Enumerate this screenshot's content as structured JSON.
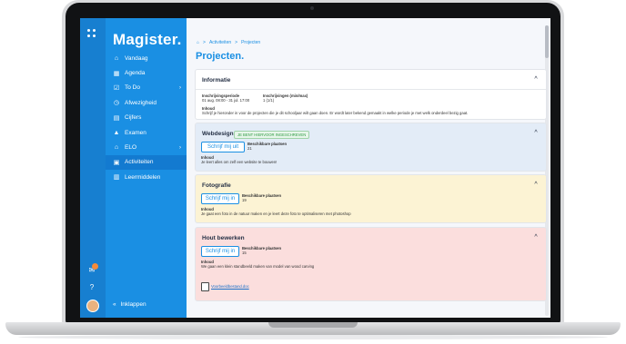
{
  "app": {
    "name": "Magister."
  },
  "sidebar": {
    "items": [
      {
        "label": "Vandaag",
        "icon": "home-icon"
      },
      {
        "label": "Agenda",
        "icon": "calendar-icon"
      },
      {
        "label": "To Do",
        "icon": "checkbox-icon",
        "chevron": "›"
      },
      {
        "label": "Afwezigheid",
        "icon": "clock-icon"
      },
      {
        "label": "Cijfers",
        "icon": "grades-icon"
      },
      {
        "label": "Examen",
        "icon": "graduation-icon"
      },
      {
        "label": "ELO",
        "icon": "elo-icon",
        "chevron": "›"
      },
      {
        "label": "Activiteiten",
        "icon": "activities-icon"
      },
      {
        "label": "Leermiddelen",
        "icon": "book-icon"
      }
    ],
    "active_index": 7,
    "collapse_label": "Inklappen",
    "collapse_icon": "«",
    "notification_count": "1"
  },
  "breadcrumb": {
    "home_icon": "⌂",
    "separator": ">",
    "items": [
      "Activiteiten",
      "Projecten"
    ]
  },
  "page": {
    "title": "Projecten."
  },
  "info_card": {
    "title": "Informatie",
    "toggle": "^",
    "period_label": "Inschrijvingsperiode",
    "period_value": "01 aug. 08:00 - 31 jul. 17:00",
    "enroll_label": "Inschrijvingen (min/max)",
    "enroll_value": "1 (1/1)",
    "content_label": "Inhoud",
    "content_text": "Schrijf je hieronder in voor de projecten die je dit schooljaar wilt gaan doen. Er wordt later bekend gemaakt in welke periode je met welk onderdeel bezig gaat."
  },
  "projects": [
    {
      "title": "Webdesign",
      "tag": "JE BENT HIERVOOR INGESCHREVEN",
      "button": "Schrijf mij uit",
      "places_label": "Beschikbare plaatsen",
      "places_value": "21",
      "content_label": "Inhoud",
      "content_text": "Je leert alles om zelf een website te bouwen!",
      "bg": "#e3ecf7"
    },
    {
      "title": "Fotografie",
      "button": "Schrijf mij in",
      "places_label": "Beschikbare plaatsen",
      "places_value": "19",
      "content_label": "Inhoud",
      "content_text": "Je gaat een foto in de natuur maken en je leert deze foto te optimaliseren met photoshop",
      "bg": "#fcf3d4"
    },
    {
      "title": "Hout bewerken",
      "button": "Schrijf mij in",
      "places_label": "Beschikbare plaatsen",
      "places_value": "15",
      "content_label": "Inhoud",
      "content_text": "We gaan een klein standbeeld maken van model van wood carving",
      "attachment": "Voorbeeldbestand.doc",
      "bg": "#fbdedd"
    }
  ],
  "colors": {
    "accent": "#1a8fe3",
    "sidebar": "#1a8fe3"
  }
}
